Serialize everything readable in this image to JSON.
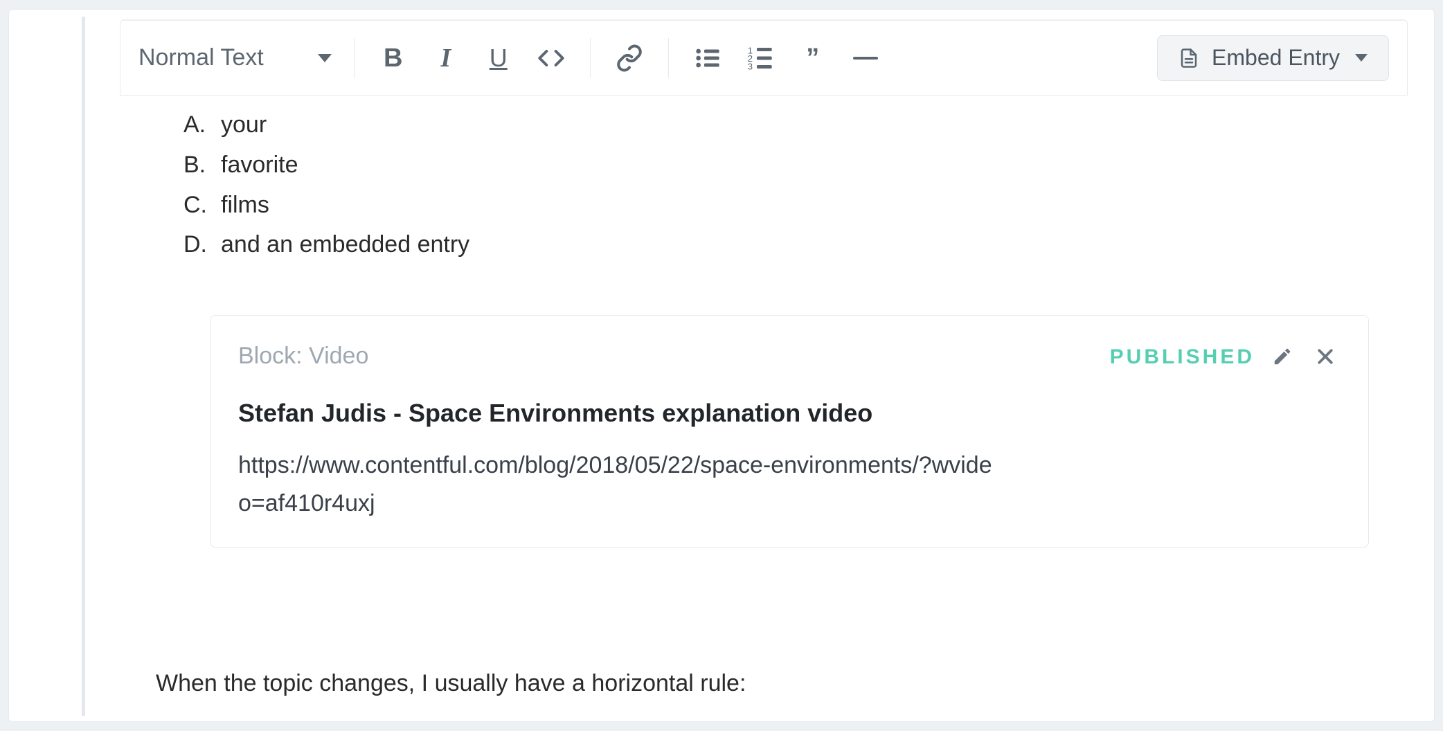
{
  "toolbar": {
    "text_style": "Normal Text",
    "embed_label": "Embed Entry"
  },
  "content": {
    "list_items": [
      {
        "marker": "A.",
        "text": "your"
      },
      {
        "marker": "B.",
        "text": "favorite"
      },
      {
        "marker": "C.",
        "text": "films"
      },
      {
        "marker": "D.",
        "text": "and an embedded entry"
      }
    ],
    "paragraph": "When the topic changes, I usually have a horizontal rule:"
  },
  "embed": {
    "type_label": "Block: Video",
    "status": "PUBLISHED",
    "title": "Stefan Judis - Space Environments explanation video",
    "url": "https://www.contentful.com/blog/2018/05/22/space-environments/?wvideo=af410r4uxj"
  }
}
